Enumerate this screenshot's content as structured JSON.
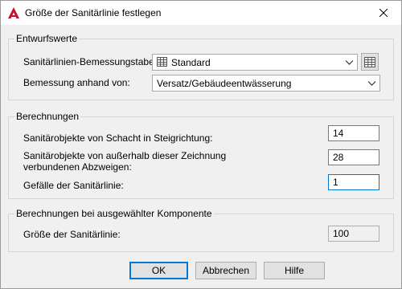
{
  "window": {
    "title": "Größe der Sanitärlinie festlegen",
    "app_icon": "autocad-a-icon",
    "close_icon": "close-icon"
  },
  "entwurfswerte": {
    "title": "Entwurfswerte",
    "table_label": "Sanitärlinien-Bemessungstabelle:",
    "table_value": "Standard",
    "table_icon": "table-icon",
    "bemessung_label": "Bemessung anhand von:",
    "bemessung_value": "Versatz/Gebäudeentwässerung"
  },
  "berechnungen": {
    "title": "Berechnungen",
    "row1_label": "Sanitärobjekte von Schacht in Steigrichtung:",
    "row1_value": "14",
    "row2_label_line1": "Sanitärobjekte von außerhalb dieser Zeichnung",
    "row2_label_line2": "verbundenen Abzweigen:",
    "row2_value": "28",
    "row3_label": "Gefälle der Sanitärlinie:",
    "row3_value": "1"
  },
  "komponente": {
    "title": "Berechnungen bei ausgewählter Komponente",
    "size_label": "Größe der Sanitärlinie:",
    "size_value": "100"
  },
  "buttons": {
    "ok": "OK",
    "abbrechen": "Abbrechen",
    "hilfe": "Hilfe"
  },
  "colors": {
    "accent": "#0078d7",
    "app_red": "#c8102e"
  }
}
